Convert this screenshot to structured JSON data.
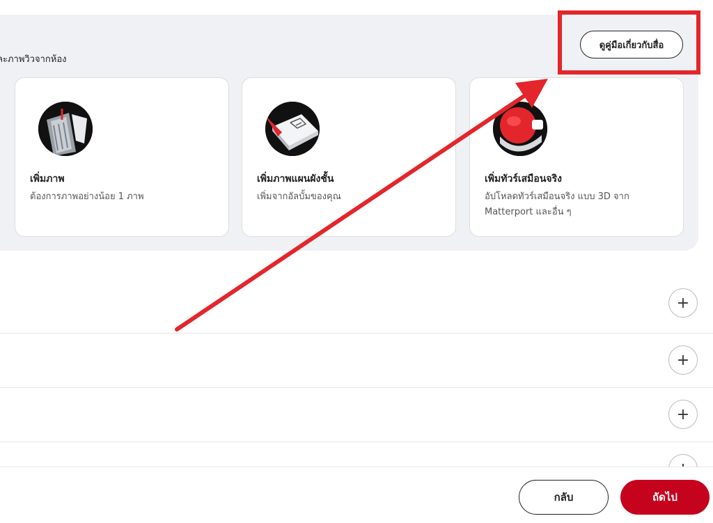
{
  "media_panel": {
    "subtitle": "ละภาพวิวจากห้อง",
    "guide_button_label": "ดูคู่มือเกี่ยวกับสื่อ"
  },
  "cards": [
    {
      "title": "เพิ่มภาพ",
      "description": "ต้องการภาพอย่างน้อย 1 ภาพ",
      "icon": "photos-illustration"
    },
    {
      "title": "เพิ่มภาพแผนผังชั้น",
      "description": "เพิ่มจากอัลบั้มของคุณ",
      "icon": "floorplan-illustration"
    },
    {
      "title": "เพิ่มทัวร์เสมือนจริง",
      "description": "อัปโหลดทัวร์เสมือนจริง แบบ 3D จาก Matterport และอื่น ๆ",
      "icon": "virtual-tour-illustration"
    }
  ],
  "accordion": {
    "expand_symbol": "+"
  },
  "footer": {
    "back_label": "กลับ",
    "next_label": "ถัดไป"
  },
  "colors": {
    "accent": "#c5031c",
    "annotation": "#e3262b",
    "panel_bg": "#f0f1f5"
  }
}
